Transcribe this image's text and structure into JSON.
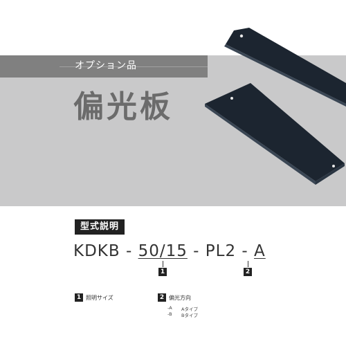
{
  "header": {
    "category": "オプション品",
    "title": "偏光板"
  },
  "model_section": {
    "label": "型式説明",
    "model_prefix": "KDKB - ",
    "part1": "50/15",
    "mid": " - PL2 - ",
    "part2": "A",
    "markers": [
      "1",
      "2"
    ]
  },
  "legend": {
    "item1": {
      "number": "1",
      "label": "照明サイズ"
    },
    "item2": {
      "number": "2",
      "label": "偏光方向"
    },
    "options": [
      {
        "code": "-A",
        "desc": "Aタイプ"
      },
      {
        "code": "-B",
        "desc": "Bタイプ"
      }
    ]
  },
  "colors": {
    "plate": "#1c2530",
    "background_gray": "#c9c9ca",
    "band": "#808080",
    "title": "#6b6b6b"
  }
}
